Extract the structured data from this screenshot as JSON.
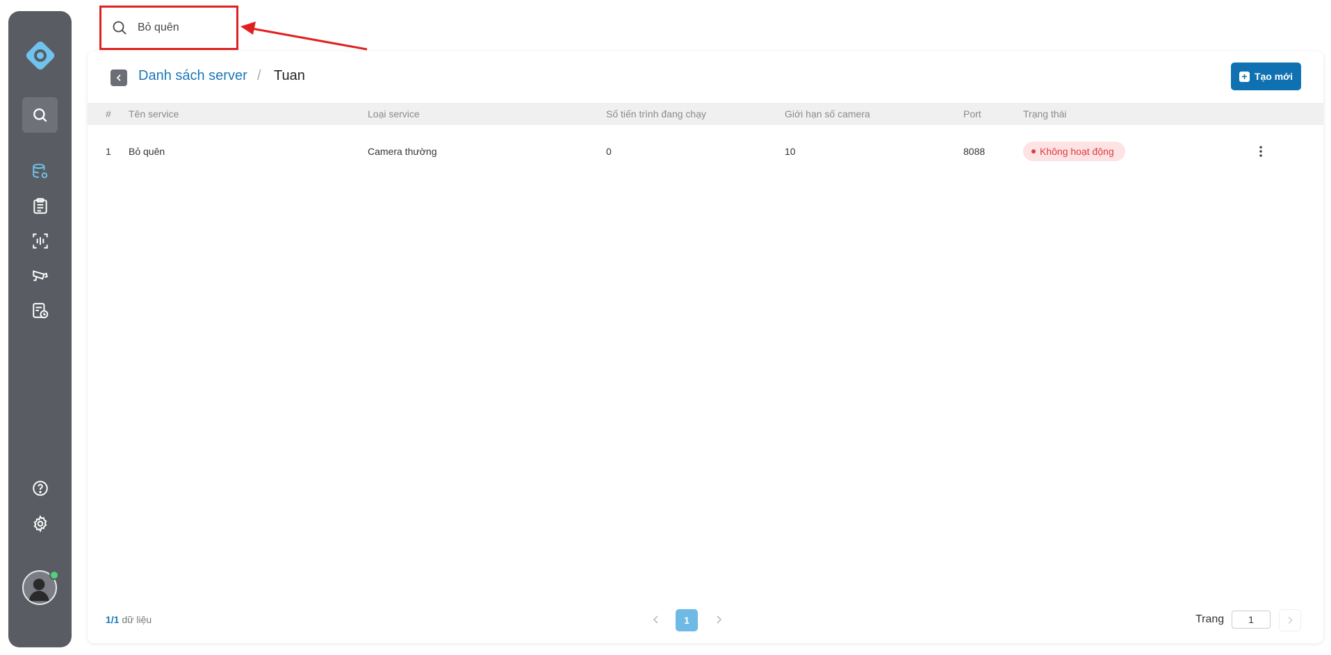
{
  "sidebar": {
    "items": [
      {
        "name": "search-icon",
        "active": true
      },
      {
        "name": "database-settings-icon"
      },
      {
        "name": "clipboard-list-icon"
      },
      {
        "name": "scan-waveform-icon"
      },
      {
        "name": "camera-icon"
      },
      {
        "name": "report-clock-icon"
      }
    ],
    "bottom": [
      {
        "name": "help-icon"
      },
      {
        "name": "gear-icon"
      }
    ],
    "accent": "#6fc3ec"
  },
  "search": {
    "value": "Bỏ quên"
  },
  "breadcrumb": {
    "parent": "Danh sách server",
    "separator": "/",
    "current": "Tuan"
  },
  "toolbar": {
    "create_label": "Tạo mới"
  },
  "table": {
    "headers": [
      "#",
      "Tên service",
      "Loại service",
      "Số tiến trình đang chạy",
      "Giới hạn số camera",
      "Port",
      "Trạng thái"
    ],
    "rows": [
      {
        "index": "1",
        "name": "Bỏ quên",
        "type": "Camera thường",
        "running_processes": "0",
        "camera_limit": "10",
        "port": "8088",
        "status": "Không hoạt động"
      }
    ]
  },
  "footer": {
    "count_current": "1",
    "count_total": "/1",
    "count_suffix": " dữ liệu",
    "current_page": "1",
    "page_label": "Trang",
    "page_input": "1"
  },
  "colors": {
    "primary": "#0f71b1",
    "status_inactive": "#e0393e",
    "highlight": "#e02020"
  }
}
